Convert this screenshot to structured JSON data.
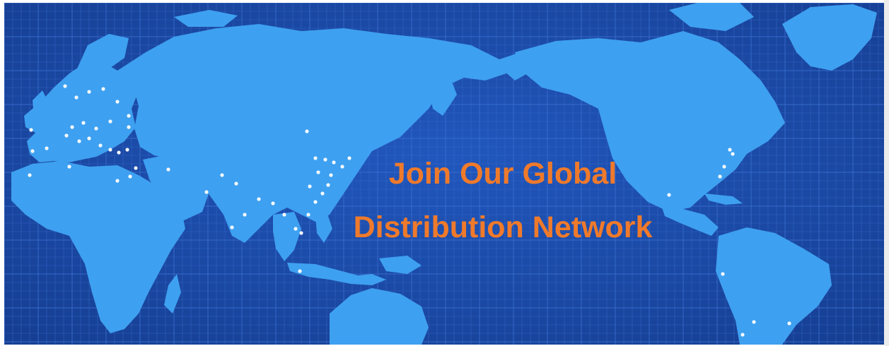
{
  "banner": {
    "headline_line1": "Join Our Global",
    "headline_line2": "Distribution Network",
    "headline_color": "#ef7a2b"
  },
  "map": {
    "ocean_color": "#1b4aa8",
    "grid_color": "#3b6fd0",
    "land_color": "#3ea0f0",
    "city_light_color": "#ffffff",
    "regions": [
      "Europe",
      "Africa",
      "Asia",
      "Australia",
      "North America",
      "South America",
      "Greenland"
    ]
  }
}
